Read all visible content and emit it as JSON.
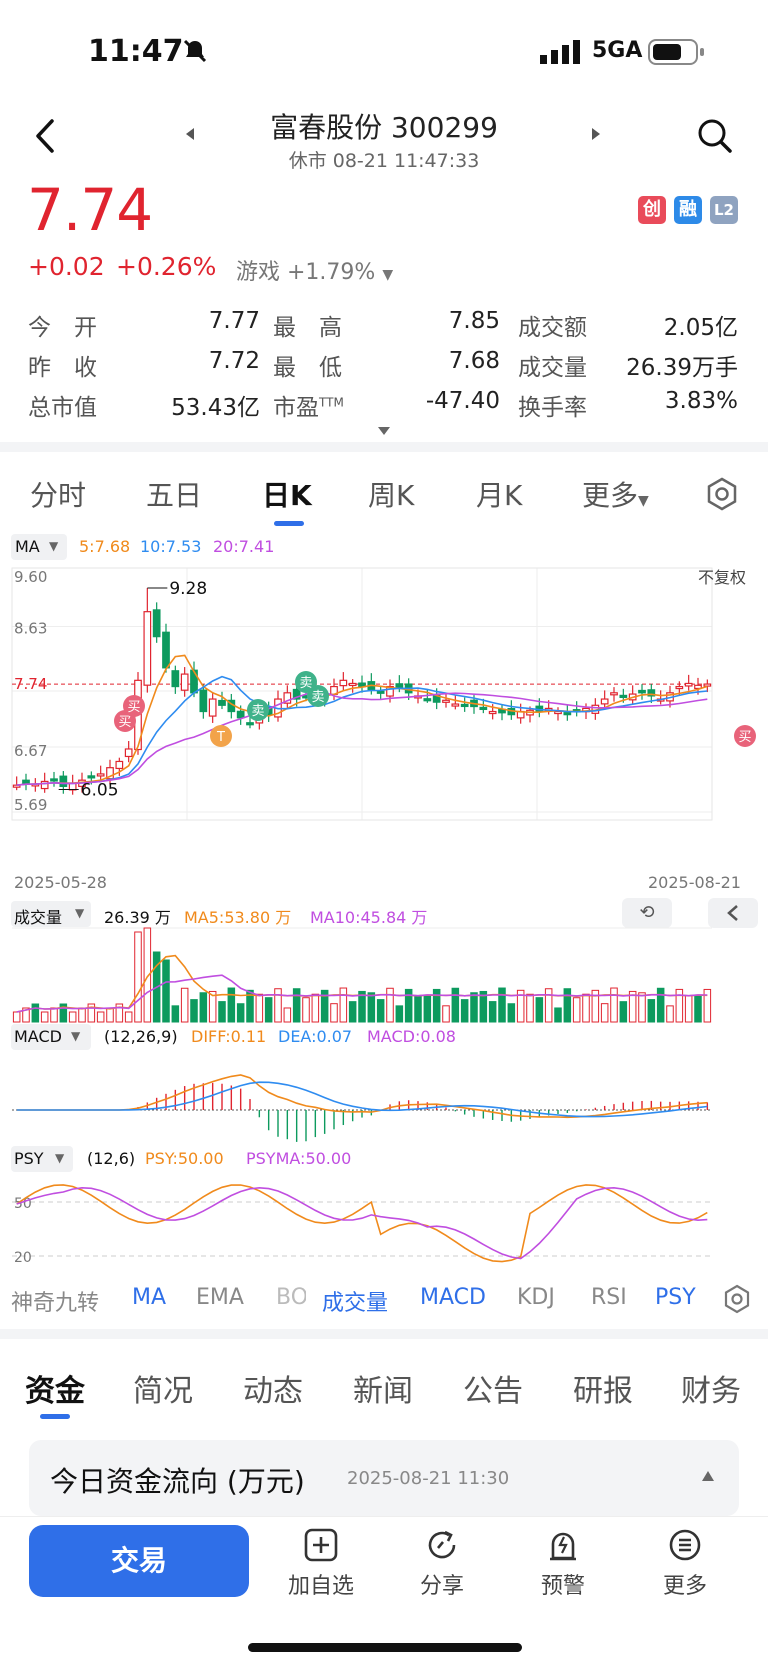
{
  "status": {
    "time": "11:47",
    "network": "5GA"
  },
  "header": {
    "title": "富春股份 300299",
    "subtitle": "休市 08-21 11:47:33"
  },
  "price": {
    "last": "7.74",
    "change": "+0.02",
    "change_pct": "+0.26%",
    "sector": "游戏 +1.79%"
  },
  "badges": [
    "创",
    "融",
    "L2"
  ],
  "quote": {
    "rows": [
      [
        {
          "label": "今　开",
          "value": "7.77",
          "color": "red"
        },
        {
          "label": "最　高",
          "value": "7.85",
          "color": "red"
        },
        {
          "label": "成交额",
          "value": "2.05亿",
          "color": "black"
        }
      ],
      [
        {
          "label": "昨　收",
          "value": "7.72",
          "color": "black"
        },
        {
          "label": "最　低",
          "value": "7.68",
          "color": "green"
        },
        {
          "label": "成交量",
          "value": "26.39万手",
          "color": "black"
        }
      ],
      [
        {
          "label": "总市值",
          "value": "53.43亿",
          "color": "black"
        },
        {
          "label": "市盈",
          "value": "-47.40",
          "color": "black"
        },
        {
          "label": "换手率",
          "value": "3.83%",
          "color": "black"
        }
      ]
    ],
    "pe_sup": "TTM"
  },
  "tabs": [
    "分时",
    "五日",
    "日K",
    "周K",
    "月K",
    "更多"
  ],
  "active_tab": "日K",
  "kchart": {
    "ma_label": "MA",
    "ma5": "5:7.68",
    "ma10": "10:7.53",
    "ma20": "20:7.41",
    "adjust": "不复权",
    "y_ticks": [
      "9.60",
      "8.63",
      "7.74",
      "6.67",
      "5.69"
    ],
    "high_mark": "9.28",
    "low_mark": "6.05",
    "start_date": "2025-05-28",
    "end_date": "2025-08-21",
    "buy": "买",
    "sell": "卖",
    "t": "T"
  },
  "volume": {
    "label": "成交量",
    "value": "26.39 万",
    "ma5": "MA5:53.80 万",
    "ma10": "MA10:45.84 万"
  },
  "macd": {
    "label": "MACD",
    "params": "(12,26,9)",
    "diff": "DIFF:0.11",
    "dea": "DEA:0.07",
    "macd": "MACD:0.08"
  },
  "psy": {
    "label": "PSY",
    "params": "(12,6)",
    "psy": "PSY:50.00",
    "psyma": "PSYMA:50.00",
    "y_ticks": [
      "50",
      "20"
    ]
  },
  "indicator_tabs": [
    "神奇九转",
    "MA",
    "EMA",
    "BO",
    "成交量",
    "MACD",
    "KDJ",
    "RSI",
    "PSY"
  ],
  "info_tabs": [
    "资金",
    "简况",
    "动态",
    "新闻",
    "公告",
    "研报",
    "财务"
  ],
  "fund_flow": {
    "title": "今日资金流向 (万元)",
    "time": "2025-08-21 11:30"
  },
  "bottom": {
    "trade": "交易",
    "items": [
      "加自选",
      "分享",
      "预警",
      "更多"
    ]
  },
  "colors": {
    "red": "#e0242f",
    "green": "#0d9a5e",
    "blue": "#2f6fe8",
    "orange": "#f08a1c",
    "purple": "#c04ee0"
  }
}
